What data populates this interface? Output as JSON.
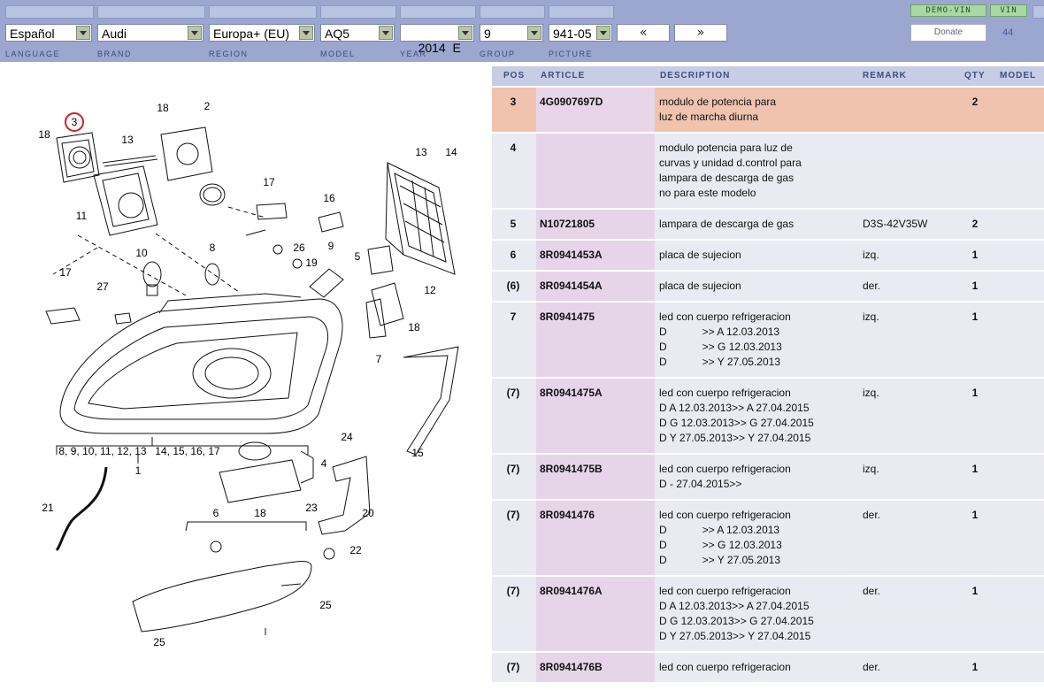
{
  "top_tabs_count": 7,
  "selectors": {
    "language": "Español",
    "brand": "Audi",
    "region": "Europa+ (EU)",
    "model": "AQ5",
    "year": "2014  E",
    "group": "9",
    "picture": "941-05"
  },
  "nav": {
    "prev": "«",
    "next": "»"
  },
  "labels": {
    "language": "LANGUAGE",
    "brand": "BRAND",
    "region": "REGION",
    "model": "MODEL",
    "year": "YEAR",
    "group": "GROUP",
    "picture": "PICTURE"
  },
  "buttons": {
    "demo_vin": "DEMO-VIN",
    "vin": "VIN",
    "donate": "Donate"
  },
  "count": "44",
  "diagram": {
    "callouts": [
      "3",
      "18",
      "2",
      "13",
      "18",
      "17",
      "16",
      "13",
      "14",
      "11",
      "8",
      "26",
      "19",
      "9",
      "10",
      "5",
      "17",
      "27",
      "12",
      "18",
      "7",
      "15",
      "24",
      "4",
      "1",
      "21",
      "18",
      "23",
      "20",
      "6",
      "22",
      "25",
      "25"
    ],
    "group_labels": [
      "8, 9, 10, 11, 12, 13",
      "14, 15, 16, 17"
    ]
  },
  "table": {
    "headers": {
      "pos": "POS",
      "article": "ARTICLE",
      "description": "DESCRIPTION",
      "remark": "REMARK",
      "qty": "QTY",
      "model": "MODEL"
    },
    "rows": [
      {
        "pos": "3",
        "article": "4G0907697D",
        "description": "modulo de potencia para\nluz de marcha diurna",
        "remark": "",
        "qty": "2",
        "highlight": true
      },
      {
        "pos": "4",
        "article": "",
        "description": "modulo potencia para luz de\ncurvas y unidad d.control para\nlampara de descarga de gas\nno para este modelo",
        "remark": "",
        "qty": ""
      },
      {
        "pos": "5",
        "article": "N10721805",
        "description": "lampara de descarga de gas",
        "remark": "D3S-42V35W",
        "qty": "2"
      },
      {
        "pos": "6",
        "article": "8R0941453A",
        "description": "placa de sujecion",
        "remark": "izq.",
        "qty": "1"
      },
      {
        "pos": "(6)",
        "article": "8R0941454A",
        "description": "placa de sujecion",
        "remark": "der.",
        "qty": "1"
      },
      {
        "pos": "7",
        "article": "8R0941475",
        "description": "led con cuerpo refrigeracion\nD            >> A 12.03.2013\nD            >> G 12.03.2013\nD            >> Y 27.05.2013",
        "remark": "izq.",
        "qty": "1"
      },
      {
        "pos": "(7)",
        "article": "8R0941475A",
        "description": "led con cuerpo refrigeracion\nD A 12.03.2013>> A 27.04.2015\nD G 12.03.2013>> G 27.04.2015\nD Y 27.05.2013>> Y 27.04.2015",
        "remark": "izq.",
        "qty": "1"
      },
      {
        "pos": "(7)",
        "article": "8R0941475B",
        "description": "led con cuerpo refrigeracion\nD - 27.04.2015>>",
        "remark": "izq.",
        "qty": "1"
      },
      {
        "pos": "(7)",
        "article": "8R0941476",
        "description": "led con cuerpo refrigeracion\nD            >> A 12.03.2013\nD            >> G 12.03.2013\nD            >> Y 27.05.2013",
        "remark": "der.",
        "qty": "1"
      },
      {
        "pos": "(7)",
        "article": "8R0941476A",
        "description": "led con cuerpo refrigeracion\nD A 12.03.2013>> A 27.04.2015\nD G 12.03.2013>> G 27.04.2015\nD Y 27.05.2013>> Y 27.04.2015",
        "remark": "der.",
        "qty": "1"
      },
      {
        "pos": "(7)",
        "article": "8R0941476B",
        "description": "led con cuerpo refrigeracion",
        "remark": "der.",
        "qty": "1"
      }
    ]
  }
}
